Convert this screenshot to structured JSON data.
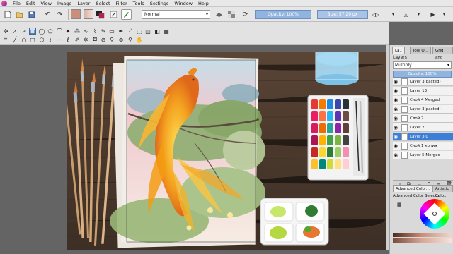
{
  "menu": [
    "File",
    "Edit",
    "View",
    "Image",
    "Layer",
    "Select",
    "Filter",
    "Tools",
    "Settings",
    "Window",
    "Help"
  ],
  "menu_underline": [
    "F",
    "E",
    "V",
    "I",
    "L",
    "S",
    "r",
    "T",
    "n",
    "W",
    "H"
  ],
  "toolbar": {
    "blend_mode": "Normal",
    "opacity_label": "Opacity:  100%",
    "size_label": "Size:  57.29 px",
    "colors": {
      "fg": "#d29a84",
      "bg": "#2c2c2c"
    }
  },
  "dock": {
    "tabs": [
      "La..",
      "Tool O...",
      "Grid and"
    ],
    "panel_title": "Layers",
    "blend_mode": "Multiply",
    "opacity_label": "Opacity:  100%",
    "layers": [
      {
        "name": "Layer 3(pasted)",
        "selected": false
      },
      {
        "name": "Layer 13",
        "selected": false
      },
      {
        "name": "Слой 4 Merged",
        "selected": false
      },
      {
        "name": "Layer 3(pasted)",
        "selected": false
      },
      {
        "name": "Слой 2",
        "selected": false
      },
      {
        "name": "Layer 2",
        "selected": false
      },
      {
        "name": "Layer 3.0",
        "selected": true
      },
      {
        "name": "Слой 1 копия",
        "selected": false
      },
      {
        "name": "Layer 5 Merged",
        "selected": false
      }
    ],
    "color_tabs": [
      "Advanced Color...",
      "Artistic Colo..."
    ],
    "color_panel_title": "Advanced Color Selector"
  }
}
